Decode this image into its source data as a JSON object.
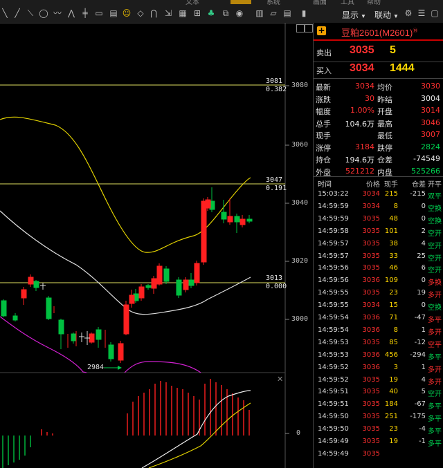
{
  "toolbar": {
    "display_label": "显示",
    "link_label": "联动",
    "top_cut": [
      "文本",
      "系统",
      "画面",
      "工具",
      "帮助"
    ]
  },
  "chart": {
    "y_labels": [
      "3080",
      "3060",
      "3040",
      "3020",
      "3000",
      "0"
    ],
    "level_high_price": "3081",
    "level_high_ratio": "0.382",
    "level_mid_price": "3047",
    "level_mid_ratio": "0.191",
    "level_low_price": "3013",
    "level_low_ratio": "0.000",
    "low_marker": "2984"
  },
  "panel": {
    "title": "豆粕2601(M2601)",
    "title_sup": "Ⓜ",
    "sell_label": "卖出",
    "sell_price": "3035",
    "sell_vol": "5",
    "buy_label": "买入",
    "buy_price": "3034",
    "buy_vol": "1444",
    "stats": [
      {
        "l1": "最新",
        "v1": "3034",
        "c1": "red",
        "l2": "均价",
        "v2": "3030",
        "c2": "red"
      },
      {
        "l1": "涨跌",
        "v1": "30",
        "c1": "red",
        "l2": "昨结",
        "v2": "3004",
        "c2": "white"
      },
      {
        "l1": "幅度",
        "v1": "1.00%",
        "c1": "red",
        "l2": "开盘",
        "v2": "3014",
        "c2": "red"
      },
      {
        "l1": "总手",
        "v1": "104.6万",
        "c1": "white",
        "l2": "最高",
        "v2": "3046",
        "c2": "red"
      },
      {
        "l1": "现手",
        "v1": "",
        "c1": "white",
        "l2": "最低",
        "v2": "3007",
        "c2": "red"
      },
      {
        "l1": "涨停",
        "v1": "3184",
        "c1": "red",
        "l2": "跌停",
        "v2": "2824",
        "c2": "green"
      },
      {
        "l1": "持仓",
        "v1": "194.6万",
        "c1": "white",
        "l2": "仓差",
        "v2": "-74549",
        "c2": "white"
      },
      {
        "l1": "外盘",
        "v1": "521212",
        "c1": "red",
        "l2": "内盘",
        "v2": "525266",
        "c2": "green"
      }
    ],
    "tick_headers": {
      "time": "时间",
      "price": "价格",
      "vol": "现手",
      "oi": "仓差",
      "type": "开平"
    },
    "ticks": [
      {
        "t": "15:03:22",
        "p": "3034",
        "pc": "red",
        "v": "215",
        "d": "-215",
        "k": "双平",
        "kc": "green"
      },
      {
        "t": "14:59:59",
        "p": "3034",
        "pc": "red",
        "v": "8",
        "d": "0",
        "k": "空换",
        "kc": "green"
      },
      {
        "t": "14:59:59",
        "p": "3035",
        "pc": "red",
        "v": "48",
        "d": "0",
        "k": "空换",
        "kc": "green"
      },
      {
        "t": "14:59:58",
        "p": "3035",
        "pc": "red",
        "v": "101",
        "d": "2",
        "k": "空开",
        "kc": "green"
      },
      {
        "t": "14:59:57",
        "p": "3035",
        "pc": "red",
        "v": "38",
        "d": "4",
        "k": "空开",
        "kc": "green"
      },
      {
        "t": "14:59:57",
        "p": "3035",
        "pc": "red",
        "v": "33",
        "d": "25",
        "k": "空开",
        "kc": "green"
      },
      {
        "t": "14:59:56",
        "p": "3035",
        "pc": "red",
        "v": "46",
        "d": "6",
        "k": "空开",
        "kc": "green"
      },
      {
        "t": "14:59:56",
        "p": "3036",
        "pc": "red",
        "v": "109",
        "d": "0",
        "k": "多换",
        "kc": "red"
      },
      {
        "t": "14:59:55",
        "p": "3035",
        "pc": "red",
        "v": "23",
        "d": "19",
        "k": "多开",
        "kc": "red"
      },
      {
        "t": "14:59:55",
        "p": "3034",
        "pc": "red",
        "v": "15",
        "d": "0",
        "k": "空换",
        "kc": "green"
      },
      {
        "t": "14:59:54",
        "p": "3036",
        "pc": "red",
        "v": "71",
        "d": "-47",
        "k": "多平",
        "kc": "red"
      },
      {
        "t": "14:59:54",
        "p": "3036",
        "pc": "red",
        "v": "8",
        "d": "1",
        "k": "多开",
        "kc": "red"
      },
      {
        "t": "14:59:53",
        "p": "3035",
        "pc": "red",
        "v": "85",
        "d": "-12",
        "k": "空平",
        "kc": "red"
      },
      {
        "t": "14:59:53",
        "p": "3036",
        "pc": "red",
        "v": "456",
        "d": "-294",
        "k": "多平",
        "kc": "green"
      },
      {
        "t": "14:59:52",
        "p": "3036",
        "pc": "red",
        "v": "3",
        "d": "1",
        "k": "多开",
        "kc": "red"
      },
      {
        "t": "14:59:52",
        "p": "3035",
        "pc": "red",
        "v": "19",
        "d": "4",
        "k": "多开",
        "kc": "red"
      },
      {
        "t": "14:59:51",
        "p": "3035",
        "pc": "red",
        "v": "40",
        "d": "5",
        "k": "空开",
        "kc": "green"
      },
      {
        "t": "14:59:51",
        "p": "3035",
        "pc": "red",
        "v": "184",
        "d": "-67",
        "k": "多平",
        "kc": "green"
      },
      {
        "t": "14:59:50",
        "p": "3035",
        "pc": "red",
        "v": "251",
        "d": "-175",
        "k": "多平",
        "kc": "green"
      },
      {
        "t": "14:59:50",
        "p": "3035",
        "pc": "red",
        "v": "23",
        "d": "-4",
        "k": "多平",
        "kc": "green"
      },
      {
        "t": "14:59:49",
        "p": "3035",
        "pc": "red",
        "v": "19",
        "d": "-1",
        "k": "多平",
        "kc": "green"
      },
      {
        "t": "14:59:49",
        "p": "3035",
        "pc": "red",
        "v": "",
        "d": "",
        "k": "",
        "kc": "green"
      }
    ]
  }
}
